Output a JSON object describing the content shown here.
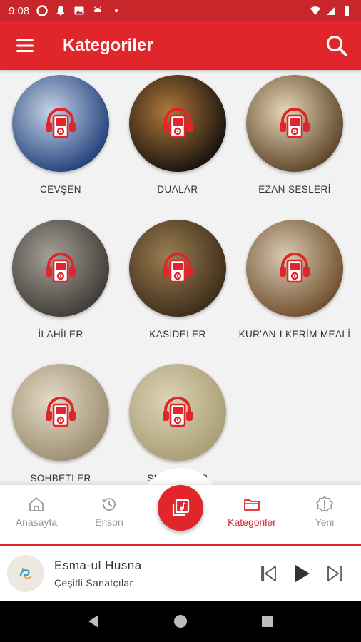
{
  "status_bar": {
    "time": "9:08"
  },
  "app_bar": {
    "title": "Kategoriler",
    "menu_icon": "hamburger-menu-icon",
    "search_icon": "search-icon"
  },
  "categories": [
    {
      "label": "CEVŞEN",
      "colors": [
        "#1d3d78",
        "#c6d3e6"
      ]
    },
    {
      "label": "DUALAR",
      "colors": [
        "#120f0d",
        "#b07838"
      ]
    },
    {
      "label": "EZAN SESLERİ",
      "colors": [
        "#5a4126",
        "#e6d6b6"
      ]
    },
    {
      "label": "İLAHİLER",
      "colors": [
        "#3c3833",
        "#a6a097"
      ]
    },
    {
      "label": "KASİDELER",
      "colors": [
        "#3a2a18",
        "#9b7d52"
      ]
    },
    {
      "label": "KUR'AN-I KERİM MEALİ",
      "colors": [
        "#6e4b29",
        "#d8cbb4"
      ]
    },
    {
      "label": "SOHBETLER",
      "colors": [
        "#9a8c70",
        "#e4dac6"
      ]
    },
    {
      "label": "SUNNETLER",
      "colors": [
        "#a89c72",
        "#dcd4b6"
      ]
    }
  ],
  "bottom_nav": {
    "items": [
      {
        "label": "Anasayfa",
        "icon": "home-icon"
      },
      {
        "label": "Enson",
        "icon": "history-icon"
      },
      {
        "label": "Kategoriler",
        "icon": "folder-icon",
        "active": true
      },
      {
        "label": "Yeni",
        "icon": "new-badge-icon"
      }
    ],
    "fab_icon": "music-library-icon"
  },
  "player": {
    "title": "Esma-ul Husna",
    "artist": "Çeşitli Sanatçılar"
  },
  "colors": {
    "primary": "#e0262a",
    "status_bar": "#c8262a",
    "inactive": "#9a9a9a"
  }
}
